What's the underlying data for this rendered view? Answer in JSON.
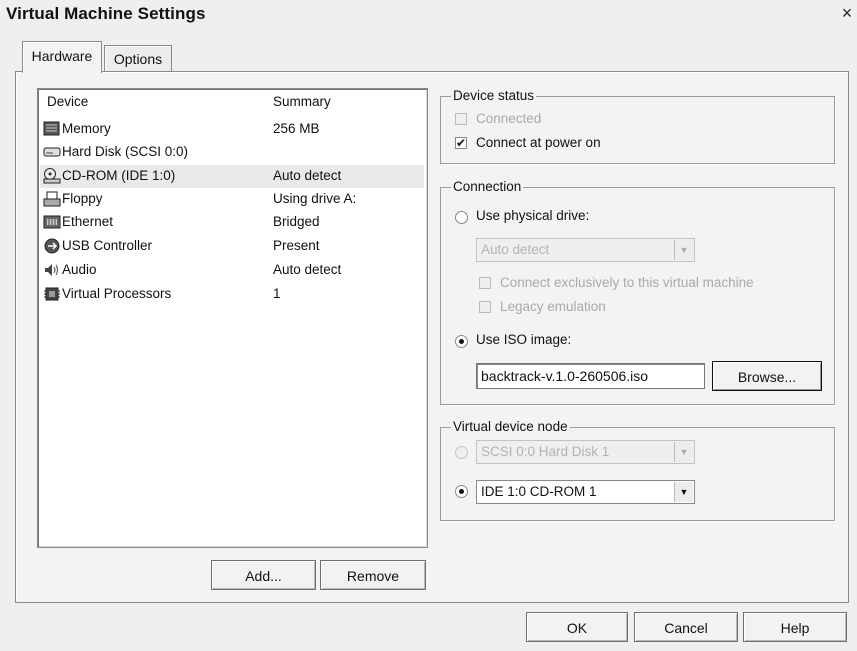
{
  "window": {
    "title": "Virtual Machine Settings",
    "close_glyph": "×"
  },
  "tabs": [
    {
      "label": "Hardware",
      "active": true
    },
    {
      "label": "Options",
      "active": false
    }
  ],
  "device_list": {
    "headers": {
      "device": "Device",
      "summary": "Summary"
    },
    "rows": [
      {
        "icon": "memory-icon",
        "name": "Memory",
        "summary": "256 MB",
        "selected": false
      },
      {
        "icon": "hard-disk-icon",
        "name": "Hard Disk (SCSI 0:0)",
        "summary": "",
        "selected": false
      },
      {
        "icon": "cdrom-icon",
        "name": "CD-ROM (IDE 1:0)",
        "summary": "Auto detect",
        "selected": true
      },
      {
        "icon": "floppy-icon",
        "name": "Floppy",
        "summary": "Using drive A:",
        "selected": false
      },
      {
        "icon": "ethernet-icon",
        "name": "Ethernet",
        "summary": "Bridged",
        "selected": false
      },
      {
        "icon": "usb-icon",
        "name": "USB Controller",
        "summary": "Present",
        "selected": false
      },
      {
        "icon": "audio-icon",
        "name": "Audio",
        "summary": "Auto detect",
        "selected": false
      },
      {
        "icon": "processor-icon",
        "name": "Virtual Processors",
        "summary": "1",
        "selected": false
      }
    ]
  },
  "list_buttons": {
    "add": "Add...",
    "remove": "Remove"
  },
  "device_status": {
    "label": "Device status",
    "connected": {
      "label": "Connected",
      "checked": false,
      "enabled": false
    },
    "connect_at_power_on": {
      "label": "Connect at power on",
      "checked": true,
      "enabled": true
    }
  },
  "connection": {
    "label": "Connection",
    "use_physical_drive": {
      "label": "Use physical drive:",
      "selected": false
    },
    "physical_drive_select": {
      "value": "Auto detect",
      "enabled": false
    },
    "connect_exclusively": {
      "label": "Connect exclusively to this virtual machine",
      "checked": false,
      "enabled": false
    },
    "legacy_emulation": {
      "label": "Legacy emulation",
      "checked": false,
      "enabled": false
    },
    "use_iso_image": {
      "label": "Use ISO image:",
      "selected": true
    },
    "iso_path": "backtrack-v.1.0-260506.iso",
    "browse": "Browse..."
  },
  "virtual_device_node": {
    "label": "Virtual device node",
    "scsi_option": {
      "value": "SCSI 0:0  Hard Disk 1",
      "selected": false,
      "enabled": false
    },
    "ide_option": {
      "value": "IDE 1:0  CD-ROM 1",
      "selected": true,
      "enabled": true
    }
  },
  "footer_buttons": {
    "ok": "OK",
    "cancel": "Cancel",
    "help": "Help"
  }
}
